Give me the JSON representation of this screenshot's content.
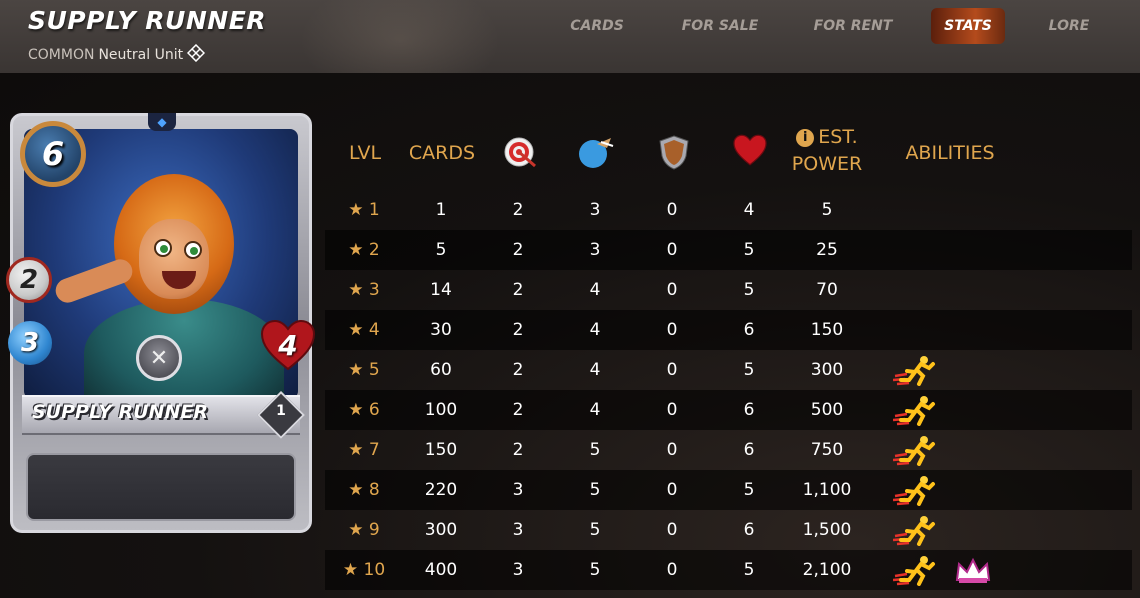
{
  "header": {
    "title": "SUPPLY RUNNER",
    "rarity": "COMMON",
    "unit_type": "Neutral Unit"
  },
  "nav": {
    "cards": "CARDS",
    "for_sale": "FOR SALE",
    "for_rent": "FOR RENT",
    "stats": "STATS",
    "lore": "LORE",
    "active": "STATS"
  },
  "card": {
    "name": "SUPPLY RUNNER",
    "mana": "6",
    "ranged": "2",
    "speed": "3",
    "health": "4",
    "level": "1"
  },
  "table": {
    "headers": {
      "lvl": "LVL",
      "cards": "CARDS",
      "ranged_icon": "ranged-attack-icon",
      "speed_icon": "speed-icon",
      "armor_icon": "armor-icon",
      "health_icon": "health-icon",
      "power_line1": "EST.",
      "power_line2": "POWER",
      "abilities": "ABILITIES"
    },
    "rows": [
      {
        "lvl": "★ 1",
        "cards": "1",
        "ranged": "2",
        "speed": "3",
        "armor": "0",
        "health": "4",
        "power": "5",
        "abilities": []
      },
      {
        "lvl": "★ 2",
        "cards": "5",
        "ranged": "2",
        "speed": "3",
        "armor": "0",
        "health": "5",
        "power": "25",
        "abilities": []
      },
      {
        "lvl": "★ 3",
        "cards": "14",
        "ranged": "2",
        "speed": "4",
        "armor": "0",
        "health": "5",
        "power": "70",
        "abilities": []
      },
      {
        "lvl": "★ 4",
        "cards": "30",
        "ranged": "2",
        "speed": "4",
        "armor": "0",
        "health": "6",
        "power": "150",
        "abilities": []
      },
      {
        "lvl": "★ 5",
        "cards": "60",
        "ranged": "2",
        "speed": "4",
        "armor": "0",
        "health": "5",
        "power": "300",
        "abilities": [
          "swiftness-icon"
        ]
      },
      {
        "lvl": "★ 6",
        "cards": "100",
        "ranged": "2",
        "speed": "4",
        "armor": "0",
        "health": "6",
        "power": "500",
        "abilities": [
          "swiftness-icon"
        ]
      },
      {
        "lvl": "★ 7",
        "cards": "150",
        "ranged": "2",
        "speed": "5",
        "armor": "0",
        "health": "6",
        "power": "750",
        "abilities": [
          "swiftness-icon"
        ]
      },
      {
        "lvl": "★ 8",
        "cards": "220",
        "ranged": "3",
        "speed": "5",
        "armor": "0",
        "health": "5",
        "power": "1,100",
        "abilities": [
          "swiftness-icon"
        ]
      },
      {
        "lvl": "★ 9",
        "cards": "300",
        "ranged": "3",
        "speed": "5",
        "armor": "0",
        "health": "6",
        "power": "1,500",
        "abilities": [
          "swiftness-icon"
        ]
      },
      {
        "lvl": "★ 10",
        "cards": "400",
        "ranged": "3",
        "speed": "5",
        "armor": "0",
        "health": "5",
        "power": "2,100",
        "abilities": [
          "swiftness-icon",
          "crown-icon"
        ]
      }
    ]
  },
  "colors": {
    "accent": "#e0a64e",
    "active_tab": "#b44b1c",
    "header_bg": "#4b4542"
  }
}
